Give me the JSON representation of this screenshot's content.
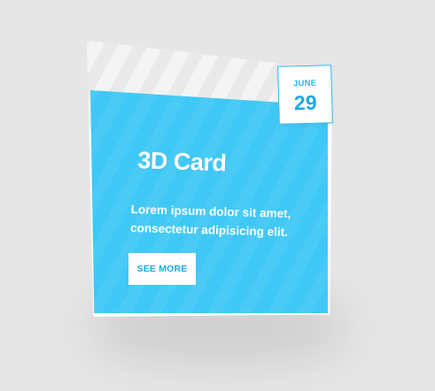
{
  "card": {
    "title": "3D Card",
    "description": "Lorem ipsum dolor sit amet, consectetur adipisicing elit.",
    "button_label": "SEE MORE",
    "date": {
      "month": "JUNE",
      "day": "29"
    }
  },
  "colors": {
    "background": "#e6e6e6",
    "card_blue": "#3fc8f6",
    "accent_blue": "#1aa9e6",
    "white": "#ffffff"
  }
}
